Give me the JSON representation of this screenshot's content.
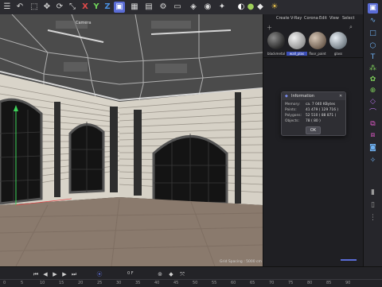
{
  "toolbar": {
    "icons": [
      "menu-icon",
      "undo-icon",
      "select-icon",
      "move-icon",
      "rotate-icon",
      "x-axis",
      "y-axis",
      "z-axis",
      "cube-icon",
      "render-icon",
      "render-view-icon",
      "render-settings-icon",
      "film-icon",
      "objects-icon",
      "camera-icon",
      "light-icon",
      "bend-icon",
      "sphere-icon",
      "subdivision-icon",
      "sun-icon"
    ],
    "x_label": "X",
    "y_label": "Y",
    "z_label": "Z"
  },
  "viewport": {
    "camera_label": "Camera",
    "grid_spacing": "Grid Spacing : 5000 cm"
  },
  "materials": {
    "menu": [
      "Create",
      "V-Ray",
      "Corona",
      "Edit",
      "View",
      "Select"
    ],
    "items": [
      {
        "label": "blackmetal",
        "color": "#3a3a3a"
      },
      {
        "label": "wall_plas",
        "color": "#b8b8b8"
      },
      {
        "label": "floor_paint",
        "color": "#8a7a6a"
      },
      {
        "label": "glass",
        "color": "#9aa4ae"
      }
    ]
  },
  "info_dialog": {
    "title": "Information",
    "rows": [
      {
        "label": "Memory:",
        "value": "ca. 7 040 KBytes"
      },
      {
        "label": "Points:",
        "value": "41 479 ( 129 716 )"
      },
      {
        "label": "Polygons:",
        "value": "52 510 ( 88 871 )"
      },
      {
        "label": "Objects:",
        "value": "78 ( 80 )"
      }
    ],
    "ok_label": "OK"
  },
  "timeline": {
    "current_frame": "0 F",
    "ticks": [
      "0",
      "5",
      "10",
      "15",
      "20",
      "25",
      "30",
      "35",
      "40",
      "45",
      "50",
      "55",
      "60",
      "65",
      "70",
      "75",
      "80",
      "85",
      "90"
    ]
  },
  "colors": {
    "accent": "#5a6cd6",
    "x_axis": "#e04a4a",
    "y_axis": "#6fd35a",
    "z_axis": "#4a8fe0"
  }
}
